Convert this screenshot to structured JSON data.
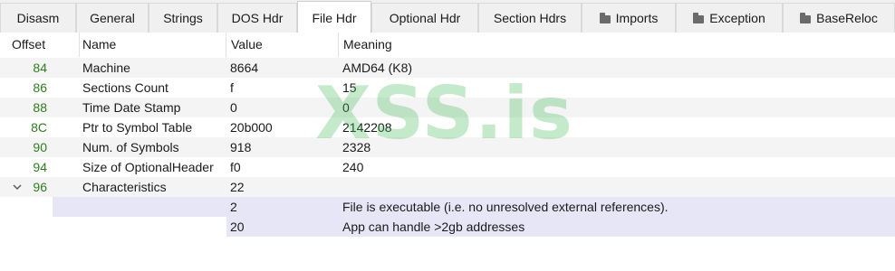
{
  "tabs": [
    {
      "label": "Disasm",
      "folder": false
    },
    {
      "label": "General",
      "folder": false
    },
    {
      "label": "Strings",
      "folder": false
    },
    {
      "label": "DOS Hdr",
      "folder": false
    },
    {
      "label": "File Hdr",
      "folder": false,
      "active": true
    },
    {
      "label": "Optional Hdr",
      "folder": false
    },
    {
      "label": "Section Hdrs",
      "folder": false
    },
    {
      "label": "Imports",
      "folder": true
    },
    {
      "label": "Exception",
      "folder": true
    },
    {
      "label": "BaseReloc",
      "folder": true
    }
  ],
  "columns": {
    "offset": "Offset",
    "name": "Name",
    "value": "Value",
    "meaning": "Meaning"
  },
  "rows": [
    {
      "offset": "84",
      "name": "Machine",
      "value": "8664",
      "meaning": "AMD64 (K8)"
    },
    {
      "offset": "86",
      "name": "Sections Count",
      "value": "f",
      "meaning": "15"
    },
    {
      "offset": "88",
      "name": "Time Date Stamp",
      "value": "0",
      "meaning": "0"
    },
    {
      "offset": "8C",
      "name": "Ptr to Symbol Table",
      "value": "20b000",
      "meaning": "2142208"
    },
    {
      "offset": "90",
      "name": "Num. of Symbols",
      "value": "918",
      "meaning": "2328"
    },
    {
      "offset": "94",
      "name": "Size of OptionalHeader",
      "value": "f0",
      "meaning": "240"
    },
    {
      "offset": "96",
      "name": "Characteristics",
      "value": "22",
      "meaning": "",
      "expanded": true
    }
  ],
  "sub_rows": [
    {
      "value": "2",
      "meaning": "File is executable  (i.e. no unresolved external references)."
    },
    {
      "value": "20",
      "meaning": "App can handle >2gb addresses"
    }
  ],
  "watermark": "XSS.is",
  "colors": {
    "offset_text": "#2e7d1f",
    "highlight": "#e6e6f7",
    "alt_row": "#f4f4f4",
    "watermark": "#4cba5c"
  }
}
